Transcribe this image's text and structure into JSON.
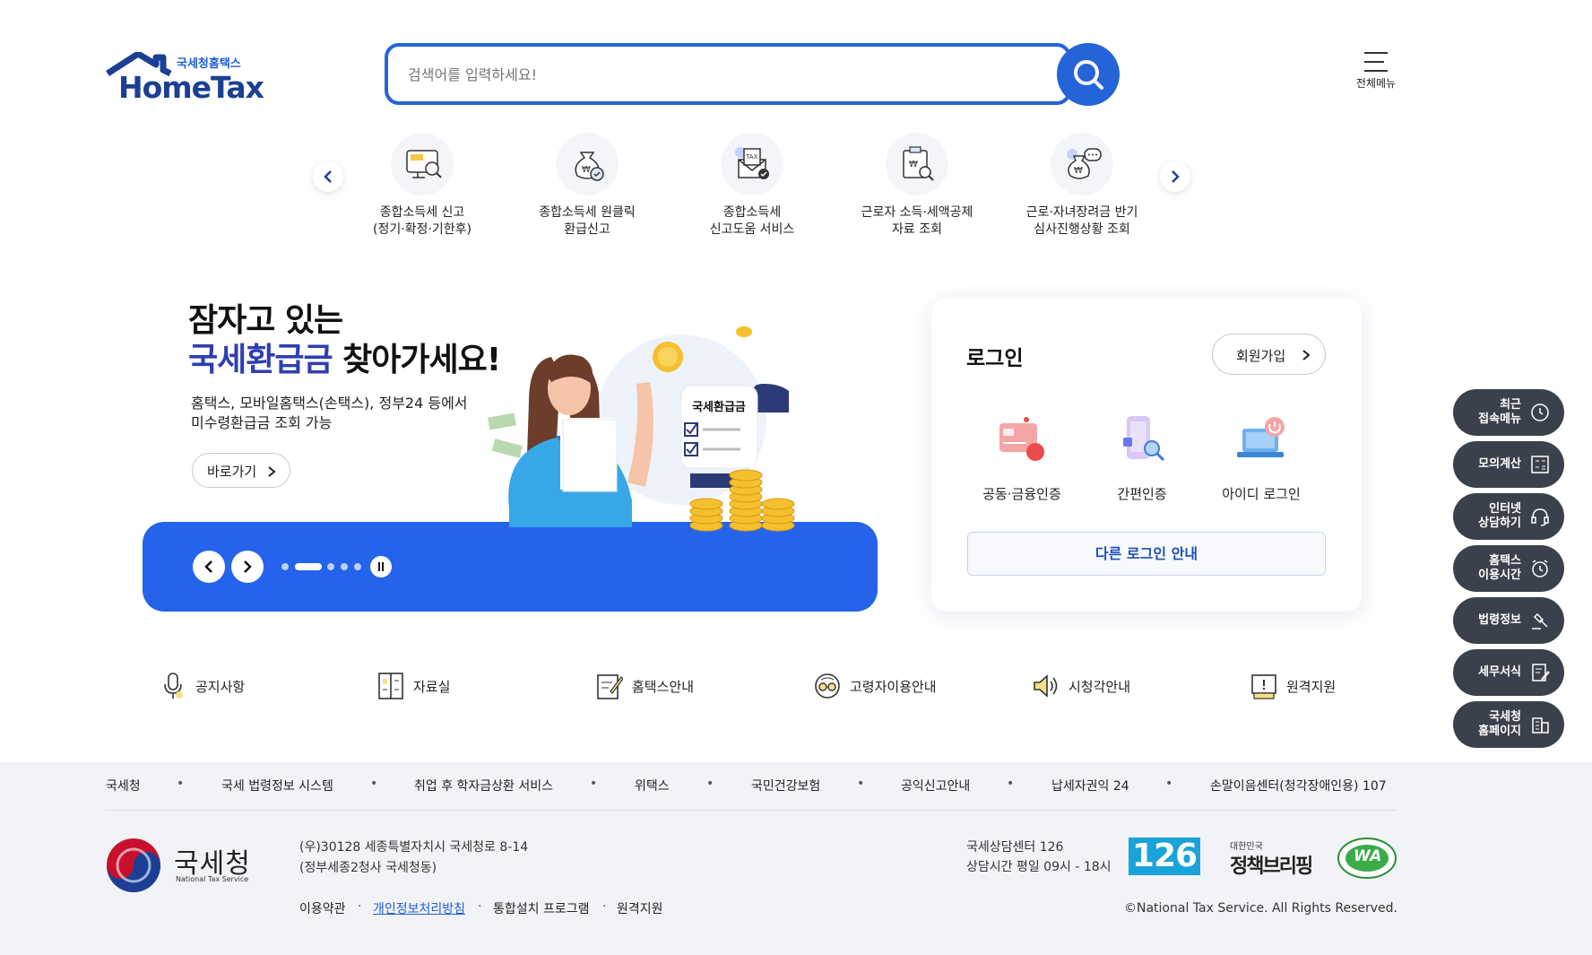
{
  "header": {
    "logo_sub": "국세청홈택스",
    "logo_main": "HomeTax",
    "search_placeholder": "검색어를 입력하세요!",
    "menu_label": "전체메뉴"
  },
  "quick_menu": [
    {
      "label": "종합소득세 신고\n(정기·확정·기한후)",
      "icon": "tax-monitor-icon"
    },
    {
      "label": "종합소득세 원클릭\n환급신고",
      "icon": "money-bag-check-icon"
    },
    {
      "label": "종합소득세\n신고도움 서비스",
      "icon": "tax-envelope-icon"
    },
    {
      "label": "근로자 소득·세액공제\n자료 조회",
      "icon": "document-search-icon"
    },
    {
      "label": "근로·자녀장려금 반기\n심사진행상황 조회",
      "icon": "money-bag-chat-icon"
    }
  ],
  "banner": {
    "title_line1": "잠자고 있는",
    "title_highlight": "국세환급금",
    "title_rest": " 찾아가세요!",
    "desc": "홈택스, 모바일홈택스(손택스), 정부24 등에서\n미수령환급금 조회 가능",
    "link_label": "바로가기",
    "illustration_label": "국세환급금",
    "slides_total": 5,
    "slide_active": 2
  },
  "login": {
    "title": "로그인",
    "signup_label": "회원가입",
    "options": [
      {
        "label": "공동·금융인증",
        "icon": "certificate-card-icon"
      },
      {
        "label": "간편인증",
        "icon": "phone-search-icon"
      },
      {
        "label": "아이디 로그인",
        "icon": "laptop-power-icon"
      }
    ],
    "other_label": "다른 로그인 안내"
  },
  "links_row": [
    {
      "label": "공지사항",
      "icon": "microphone-icon"
    },
    {
      "label": "자료실",
      "icon": "folder-cabinet-icon"
    },
    {
      "label": "홈택스안내",
      "icon": "document-pen-icon"
    },
    {
      "label": "고령자이용안내",
      "icon": "senior-glasses-icon"
    },
    {
      "label": "시청각안내",
      "icon": "speaker-icon"
    },
    {
      "label": "원격지원",
      "icon": "remote-monitor-icon"
    }
  ],
  "side_menu": [
    {
      "label": "최근\n접속메뉴",
      "icon": "clock-icon"
    },
    {
      "label": "모의계산",
      "icon": "calculator-icon"
    },
    {
      "label": "인터넷\n상담하기",
      "icon": "headset-icon"
    },
    {
      "label": "홈택스\n이용시간",
      "icon": "alarm-clock-icon"
    },
    {
      "label": "법령정보",
      "icon": "gavel-icon"
    },
    {
      "label": "세무서식",
      "icon": "form-pen-icon"
    },
    {
      "label": "국세청\n홈페이지",
      "icon": "building-icon"
    }
  ],
  "footer": {
    "links": [
      "국세청",
      "국세 법령정보 시스템",
      "취업 후 학자금상환 서비스",
      "위택스",
      "국민건강보험",
      "공익신고안내",
      "납세자권익 24",
      "손말이음센터(청각장애인용) 107"
    ],
    "org_name": "국세청",
    "org_en": "National Tax Service",
    "address": "(우)30128 세종특별자치시 국세청로 8-14\n(정부세종2청사 국세청동)",
    "bottom_links": [
      "이용약관",
      "개인정보처리방침",
      "통합설치 프로그램",
      "원격지원"
    ],
    "center": "국세상담센터 126\n상담시간 평일 09시 - 18시",
    "badge_126": "126",
    "badge_policy_small": "대한민국",
    "badge_policy": "정책브리핑",
    "badge_wa": "WA",
    "copyright": "©National Tax Service. All Rights Reserved."
  },
  "colors": {
    "primary": "#2563d8",
    "banner": "#2563eb",
    "side": "#3a414c",
    "navy": "#1b3f94"
  }
}
